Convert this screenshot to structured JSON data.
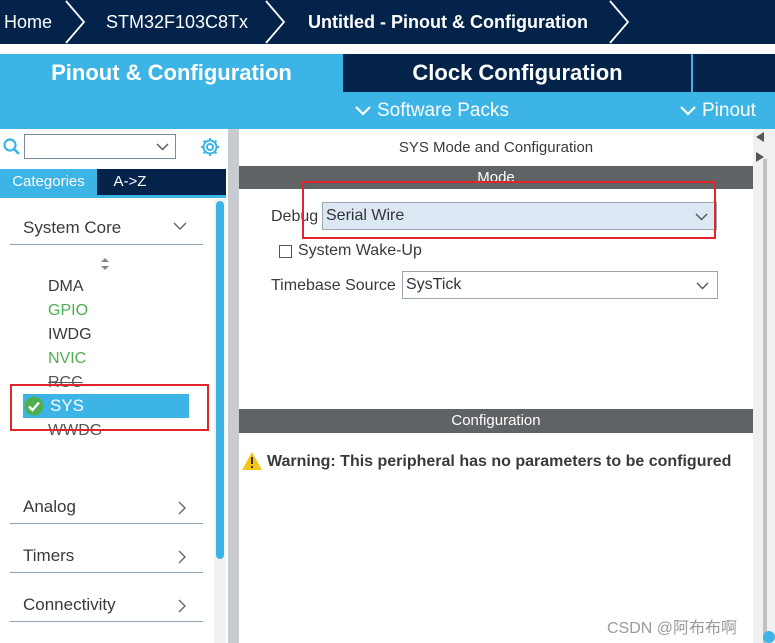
{
  "breadcrumbs": [
    "Home",
    "STM32F103C8Tx",
    "Untitled - Pinout & Configuration"
  ],
  "tabs": {
    "pinout": "Pinout & Configuration",
    "clock": "Clock Configuration"
  },
  "subbar": {
    "software_packs": "Software Packs",
    "pinout": "Pinout"
  },
  "left": {
    "search_value": "",
    "category_tabs": [
      "Categories",
      "A->Z"
    ],
    "groups": {
      "system_core": "System Core",
      "analog": "Analog",
      "timers": "Timers",
      "connectivity": "Connectivity"
    },
    "peripherals": [
      "DMA",
      "GPIO",
      "IWDG",
      "NVIC",
      "RCC",
      "SYS",
      "WWDG"
    ]
  },
  "right": {
    "title": "SYS Mode and Configuration",
    "mode_header": "Mode",
    "debug_label": "Debug",
    "debug_value": "Serial Wire",
    "wake_label": "System Wake-Up",
    "wake_checked": false,
    "timebase_label": "Timebase Source",
    "timebase_value": "SysTick",
    "config_header": "Configuration",
    "warning": "Warning: This peripheral has no parameters to be configured"
  },
  "colors": {
    "navy": "#03234b",
    "accent": "#3cb4e6",
    "enabled_green": "#4caf50",
    "annotation_red": "#e0262a",
    "bar_grey": "#5f6365"
  },
  "watermark": "CSDN @阿布布啊"
}
